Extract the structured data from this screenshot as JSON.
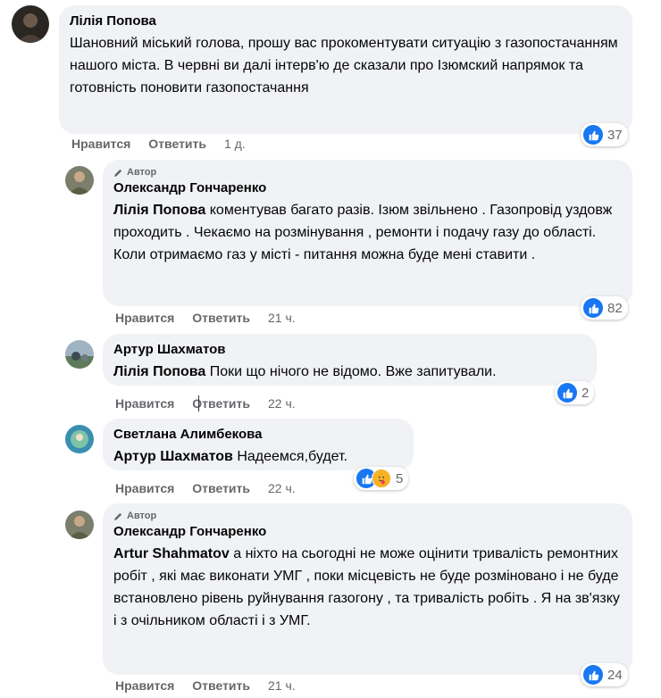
{
  "labels": {
    "like": "Нравится",
    "reply": "Ответить",
    "author": "Автор"
  },
  "colors": {
    "bubble": "#f0f2f5",
    "like_blue": "#1877f2",
    "meta_gray": "#65676b"
  },
  "comments": [
    {
      "name": "Лілія Попова",
      "text": "Шановний міський голова, прошу вас прокоментувати ситуацію з газопостачанням нашого міста. В червні ви далі інтерв'ю де сказали про Ізюмский напрямок та готовність поновити газопостачання",
      "time": "1 д.",
      "reactions": 37
    },
    {
      "name": "Олександр Гончаренко",
      "is_author": true,
      "mention": "Лілія Попова",
      "text": " коментував багато разів. Ізюм звільнено . Газопровід уздовж проходить . Чекаємо на розмінування , ремонти і подачу газу до області. Коли отримаємо газ у місті - питання можна буде мені ставити .",
      "time": "21 ч.",
      "reactions": 82
    },
    {
      "name": "Артур Шахматов",
      "mention": "Лілія Попова",
      "text": " Поки що нічого не відомо. Вже запитували.",
      "time": "22 ч.",
      "reactions": 2
    },
    {
      "name": "Светлана Алимбекова",
      "mention": "Артур Шахматов",
      "text": " Надеемся,будет.",
      "time": "22 ч.",
      "reactions": 5
    },
    {
      "name": "Олександр Гончаренко",
      "is_author": true,
      "mention": "Artur Shahmatov",
      "text": " а ніхто на сьогодні не може оцінити тривалість ремонтних робіт , які має виконати УМГ , поки місцевість не буде розміновано і не буде встановлено рівень руйнування газогону , та тривалість робіть . Я на зв'язку і з очільником області і з УМГ.",
      "time": "21 ч.",
      "reactions": 24
    }
  ]
}
